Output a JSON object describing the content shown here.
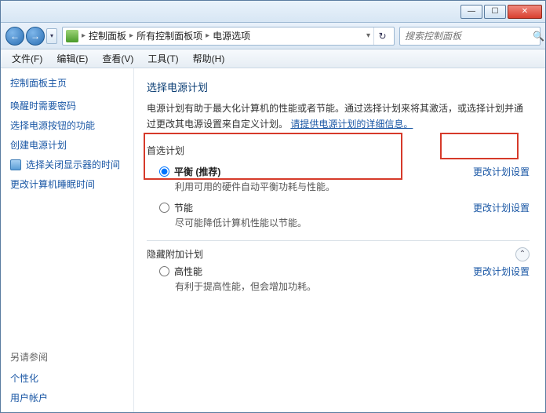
{
  "titlebar": {
    "min": "—",
    "max": "☐",
    "close": "✕"
  },
  "nav": {
    "back": "←",
    "fwd": "→",
    "drop": "▾",
    "refresh": "↻"
  },
  "breadcrumb": {
    "c1": "控制面板",
    "c2": "所有控制面板项",
    "c3": "电源选项",
    "sep": "▸",
    "drop": "▾"
  },
  "search": {
    "placeholder": "搜索控制面板",
    "icon": "🔍"
  },
  "menu": {
    "file": "文件(F)",
    "edit": "编辑(E)",
    "view": "查看(V)",
    "tools": "工具(T)",
    "help": "帮助(H)"
  },
  "sidebar": {
    "home": "控制面板主页",
    "l1": "唤醒时需要密码",
    "l2": "选择电源按钮的功能",
    "l3": "创建电源计划",
    "l4": "选择关闭显示器的时间",
    "l5": "更改计算机睡眠时间",
    "seealso_h": "另请参阅",
    "s1": "个性化",
    "s2": "用户帐户"
  },
  "content": {
    "h1": "选择电源计划",
    "desc1": "电源计划有助于最大化计算机的性能或者节能。通过选择计划来将其激活，或选择计划并通过更改其电源设置来自定义计划。",
    "desc_link": "请提供电源计划的详细信息。",
    "preferred_h": "首选计划",
    "hidden_h": "隐藏附加计划",
    "change": "更改计划设置",
    "plans": {
      "balanced": {
        "name": "平衡 (推荐)",
        "desc": "利用可用的硬件自动平衡功耗与性能。"
      },
      "saver": {
        "name": "节能",
        "desc": "尽可能降低计算机性能以节能。"
      },
      "high": {
        "name": "高性能",
        "desc": "有利于提高性能，但会增加功耗。"
      }
    }
  }
}
